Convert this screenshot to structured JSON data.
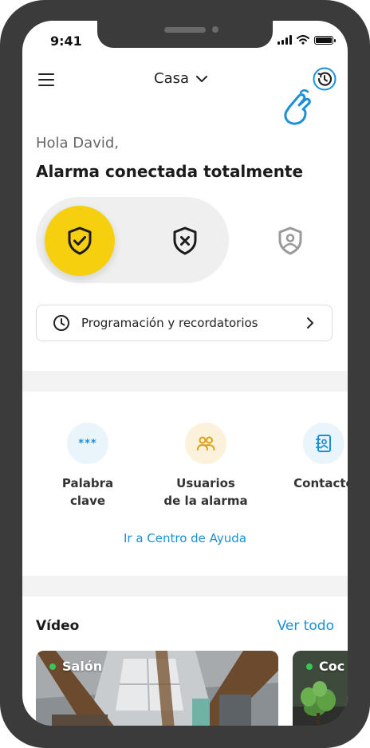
{
  "status_bar": {
    "time": "9:41"
  },
  "header": {
    "home_name": "Casa"
  },
  "greeting": "Hola David,",
  "alarm_status": "Alarma conectada totalmente",
  "modes": [
    {
      "id": "armed",
      "icon": "shield-check-icon",
      "color": "#f6cf0f"
    },
    {
      "id": "disarmed",
      "icon": "shield-x-icon"
    },
    {
      "id": "partial",
      "icon": "shield-user-icon"
    }
  ],
  "schedule": {
    "label": "Programación y recordatorios"
  },
  "shortcuts": [
    {
      "label": "Palabra\nclave",
      "icon": "password-dots-icon",
      "dots": "***"
    },
    {
      "label": "Usuarios\nde la alarma",
      "icon": "users-icon"
    },
    {
      "label": "Contacto",
      "icon": "contacts-icon"
    }
  ],
  "help_link": "Ir a Centro de Ayuda",
  "video": {
    "title": "Vídeo",
    "see_all": "Ver todo",
    "cameras": [
      {
        "name": "Salón"
      },
      {
        "name": "Coc"
      }
    ]
  },
  "colors": {
    "accent_yellow": "#f6cf0f",
    "link_blue": "#1d8fd6",
    "live_green": "#3cc45a"
  }
}
